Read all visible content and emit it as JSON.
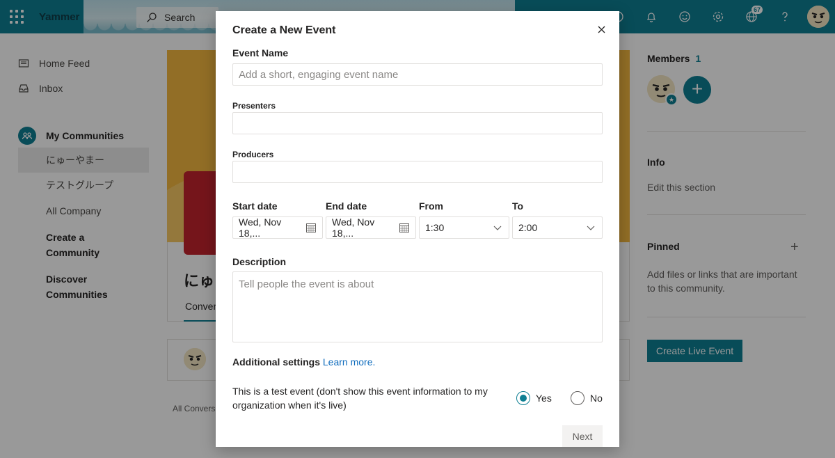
{
  "app": {
    "name": "Yammer"
  },
  "search": {
    "label": "Search"
  },
  "topbar": {
    "notification_badge": "67"
  },
  "leftnav": {
    "home_feed": "Home Feed",
    "inbox": "Inbox",
    "my_communities": "My Communities",
    "communities": [
      "にゅーやまー",
      "テストグループ",
      "All Company"
    ],
    "create_community": "Create a\nCommunity",
    "discover_communities": "Discover\nCommunities"
  },
  "feed": {
    "group_title": "にゅ",
    "tab": "Conver",
    "all_conversations": "All Conversa"
  },
  "rail": {
    "members_label": "Members",
    "members_count": "1",
    "info_label": "Info",
    "info_edit": "Edit this section",
    "pinned_label": "Pinned",
    "pinned_text": "Add files or links that are important to this community.",
    "live_event_button": "Create Live Event"
  },
  "modal": {
    "title": "Create a New Event",
    "event_name_label": "Event Name",
    "event_name_placeholder": "Add a short, engaging event name",
    "event_name_value": "",
    "presenters_label": "Presenters",
    "producers_label": "Producers",
    "start_date_label": "Start date",
    "start_date_value": "Wed, Nov 18,...",
    "end_date_label": "End date",
    "end_date_value": "Wed, Nov 18,...",
    "from_label": "From",
    "from_value": "1:30",
    "to_label": "To",
    "to_value": "2:00",
    "description_label": "Description",
    "description_placeholder": "Tell people the event is about",
    "additional_settings_label": "Additional settings",
    "learn_more": "Learn more.",
    "test_event_text": "This is a test event (don't show this event information to my organization when it's live)",
    "yes_label": "Yes",
    "no_label": "No",
    "test_event_selected": "Yes",
    "next_button": "Next"
  },
  "colors": {
    "accent": "#0e7f93",
    "link": "#0f6cbd",
    "cover": "#f4b740",
    "group_logo": "#c4232d"
  }
}
